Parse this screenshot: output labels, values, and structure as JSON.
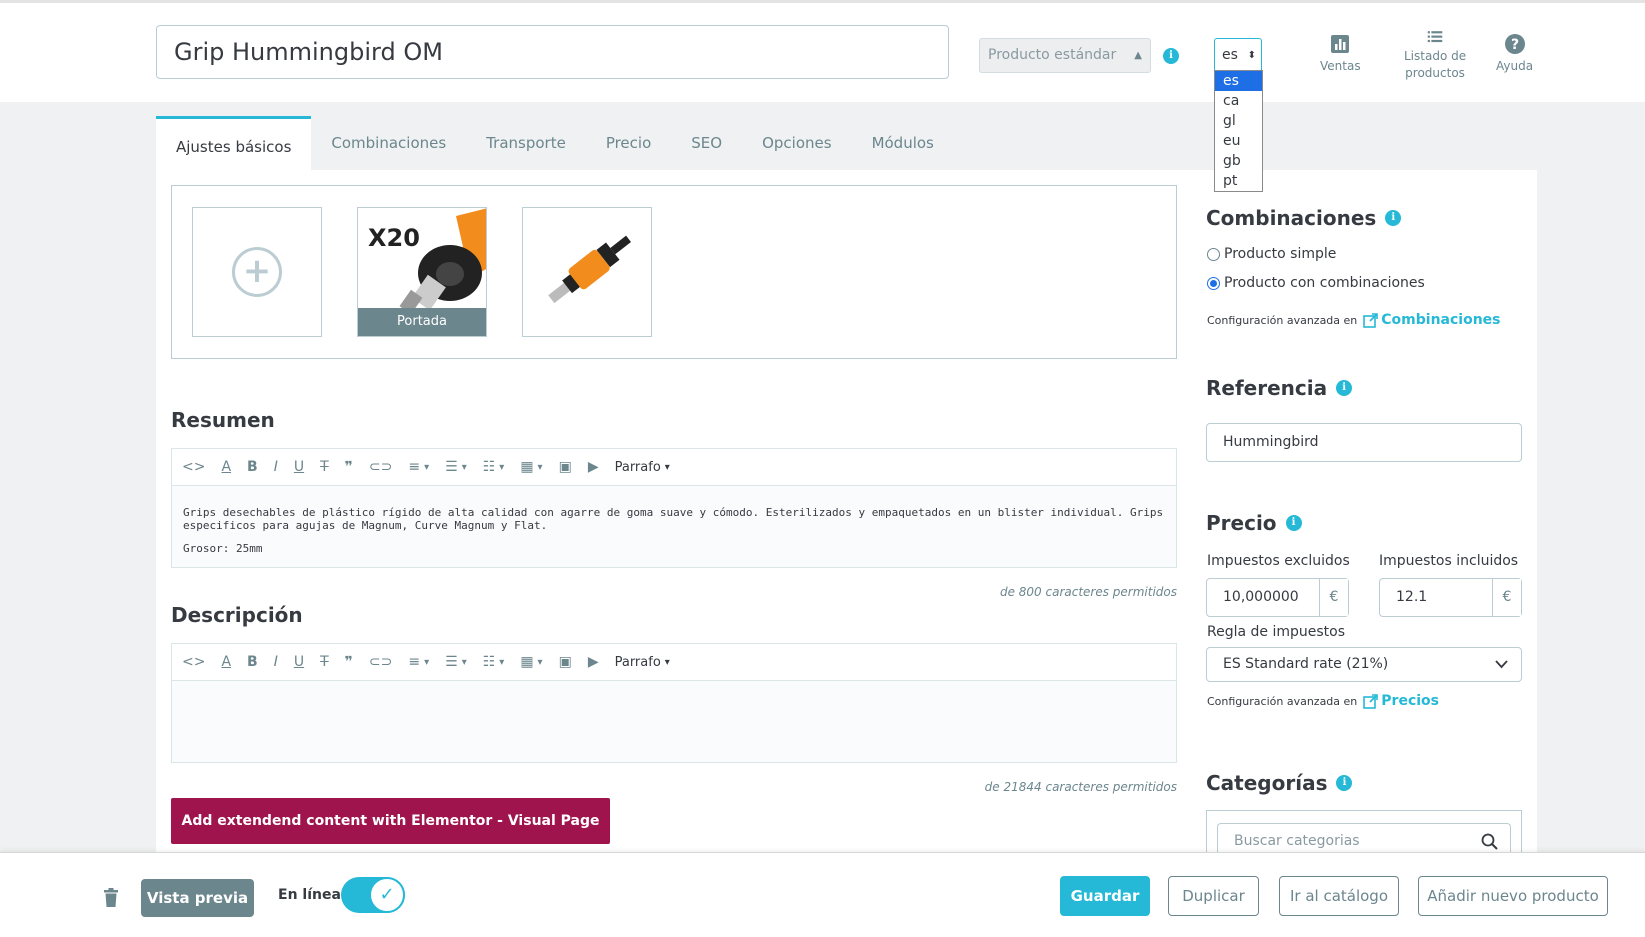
{
  "header": {
    "product_name": "Grip Hummingbird OM",
    "product_type": "Producto estándar",
    "language": "es",
    "language_options": [
      "es",
      "ca",
      "gl",
      "eu",
      "gb",
      "pt"
    ],
    "tools": {
      "sales": "Ventas",
      "product_list_line1": "Listado de",
      "product_list_line2": "productos",
      "help": "Ayuda"
    }
  },
  "tabs": [
    "Ajustes básicos",
    "Combinaciones",
    "Transporte",
    "Precio",
    "SEO",
    "Opciones",
    "Módulos"
  ],
  "images": {
    "cover_label": "Portada",
    "thumb1_text": "X20"
  },
  "summary": {
    "title": "Resumen",
    "paragraph1": "Grips desechables de plástico rígido de alta calidad con agarre de goma suave y cómodo. Esterilizados y empaquetados en un blister individual. Grips especificos para agujas de Magnum, Curve Magnum y Flat.",
    "paragraph2": "Grosor: 25mm",
    "char_limit": "de 800 caracteres permitidos"
  },
  "description": {
    "title": "Descripción",
    "char_limit": "de 21844 caracteres permitidos"
  },
  "editor_toolbar": {
    "format_label": "Parrafo"
  },
  "elementor_button": "Add extendend content with Elementor - Visual Page Builder",
  "combinations": {
    "title": "Combinaciones",
    "option_simple": "Producto simple",
    "option_combinations": "Producto con combinaciones",
    "advanced_prefix": "Configuración avanzada en",
    "advanced_link": "Combinaciones"
  },
  "reference": {
    "title": "Referencia",
    "value": "Hummingbird"
  },
  "price": {
    "title": "Precio",
    "tax_excl_label": "Impuestos excluidos",
    "tax_excl_value": "10,000000",
    "tax_incl_label": "Impuestos incluidos",
    "tax_incl_value": "12.1",
    "currency": "€",
    "tax_rule_label": "Regla de impuestos",
    "tax_rule_value": "ES Standard rate (21%)",
    "advanced_prefix": "Configuración avanzada en",
    "advanced_link": "Precios"
  },
  "categories": {
    "title": "Categorías",
    "search_placeholder": "Buscar categorias"
  },
  "footer": {
    "preview": "Vista previa",
    "online_label": "En línea",
    "save": "Guardar",
    "duplicate": "Duplicar",
    "catalog": "Ir al catálogo",
    "new_product": "Añadir nuevo producto"
  },
  "colors": {
    "accent": "#25b9d7",
    "elementor": "#a0144e",
    "muted": "#6c868e"
  }
}
